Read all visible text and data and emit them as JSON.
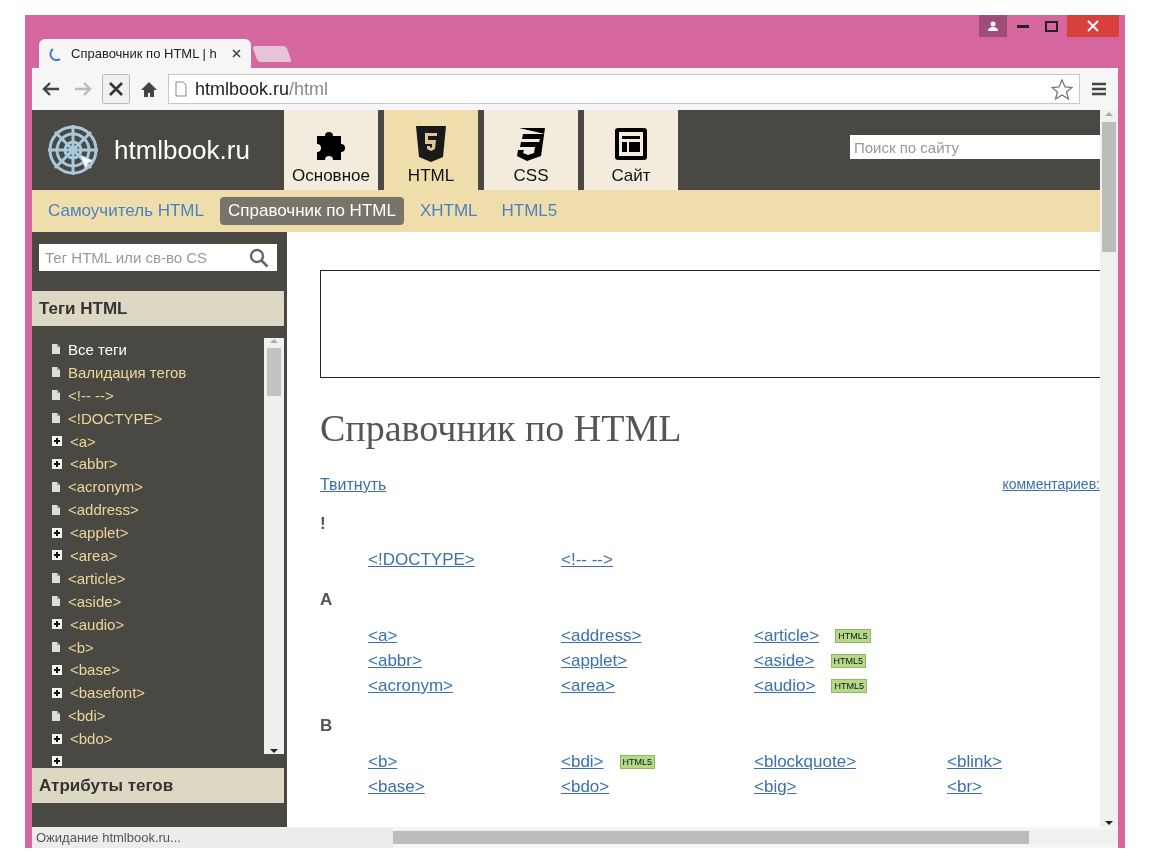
{
  "browser": {
    "tabs": [
      {
        "title": "Справочник по HTML | h",
        "selected": true
      }
    ],
    "address": {
      "host": "htmlbook.ru",
      "path": "/html"
    }
  },
  "site": {
    "logo": "htmlbook.ru",
    "sections": [
      {
        "label": "Основное",
        "selected": false
      },
      {
        "label": "HTML",
        "selected": true
      },
      {
        "label": "CSS",
        "selected": false
      },
      {
        "label": "Сайт",
        "selected": false
      }
    ],
    "search": {
      "placeholder": "Поиск по сайту"
    },
    "subnav": [
      {
        "label": "Самоучитель HTML",
        "selected": false
      },
      {
        "label": "Справочник по HTML",
        "selected": true
      },
      {
        "label": "XHTML",
        "selected": false
      },
      {
        "label": "HTML5",
        "selected": false
      }
    ]
  },
  "sidebar": {
    "search": {
      "placeholder": "Тег HTML или св-во CS"
    },
    "panel_title": "Теги HTML",
    "items": [
      {
        "label": "Все теги",
        "kind": "doc",
        "selected": true
      },
      {
        "label": "Валидация тегов",
        "kind": "doc",
        "selected": false
      },
      {
        "label": "<!-- -->",
        "kind": "doc",
        "selected": false
      },
      {
        "label": "<!DOCTYPE>",
        "kind": "doc",
        "selected": false
      },
      {
        "label": "<a>",
        "kind": "plus",
        "selected": false
      },
      {
        "label": "<abbr>",
        "kind": "plus",
        "selected": false
      },
      {
        "label": "<acronym>",
        "kind": "doc",
        "selected": false
      },
      {
        "label": "<address>",
        "kind": "doc",
        "selected": false
      },
      {
        "label": "<applet>",
        "kind": "plus",
        "selected": false
      },
      {
        "label": "<area>",
        "kind": "plus",
        "selected": false
      },
      {
        "label": "<article>",
        "kind": "doc",
        "selected": false
      },
      {
        "label": "<aside>",
        "kind": "doc",
        "selected": false
      },
      {
        "label": "<audio>",
        "kind": "plus",
        "selected": false
      },
      {
        "label": "<b>",
        "kind": "doc",
        "selected": false
      },
      {
        "label": "<base>",
        "kind": "plus",
        "selected": false
      },
      {
        "label": "<basefont>",
        "kind": "plus",
        "selected": false
      },
      {
        "label": "<bdi>",
        "kind": "doc",
        "selected": false
      },
      {
        "label": "<bdo>",
        "kind": "plus",
        "selected": false
      }
    ],
    "cut_item": {
      "kind": "plus"
    },
    "footer_title": "Атрибуты тегов"
  },
  "content": {
    "heading": "Справочник по HTML",
    "tweet": "Твитнуть",
    "comments": "комментариев:",
    "groups": [
      {
        "letter": "!",
        "columns": [
          [
            {
              "label": "<!DOCTYPE>"
            }
          ],
          [
            {
              "label": "<!-- -->"
            }
          ]
        ]
      },
      {
        "letter": "A",
        "columns": [
          [
            {
              "label": "<a>"
            },
            {
              "label": "<abbr>"
            },
            {
              "label": "<acronym>"
            }
          ],
          [
            {
              "label": "<address>"
            },
            {
              "label": "<applet>"
            },
            {
              "label": "<area>"
            }
          ],
          [
            {
              "label": "<article>",
              "badge": "HTML5"
            },
            {
              "label": "<aside>",
              "badge": "HTML5"
            },
            {
              "label": "<audio>",
              "badge": "HTML5"
            }
          ]
        ]
      },
      {
        "letter": "B",
        "columns": [
          [
            {
              "label": "<b>"
            },
            {
              "label": "<base>"
            }
          ],
          [
            {
              "label": "<bdi>",
              "badge": "HTML5"
            },
            {
              "label": "<bdo>"
            }
          ],
          [
            {
              "label": "<blockquote>"
            },
            {
              "label": "<big>"
            }
          ],
          [
            {
              "label": "<blink>"
            },
            {
              "label": "<br>"
            }
          ]
        ]
      }
    ]
  },
  "status": "Ожидание htmlbook.ru..."
}
